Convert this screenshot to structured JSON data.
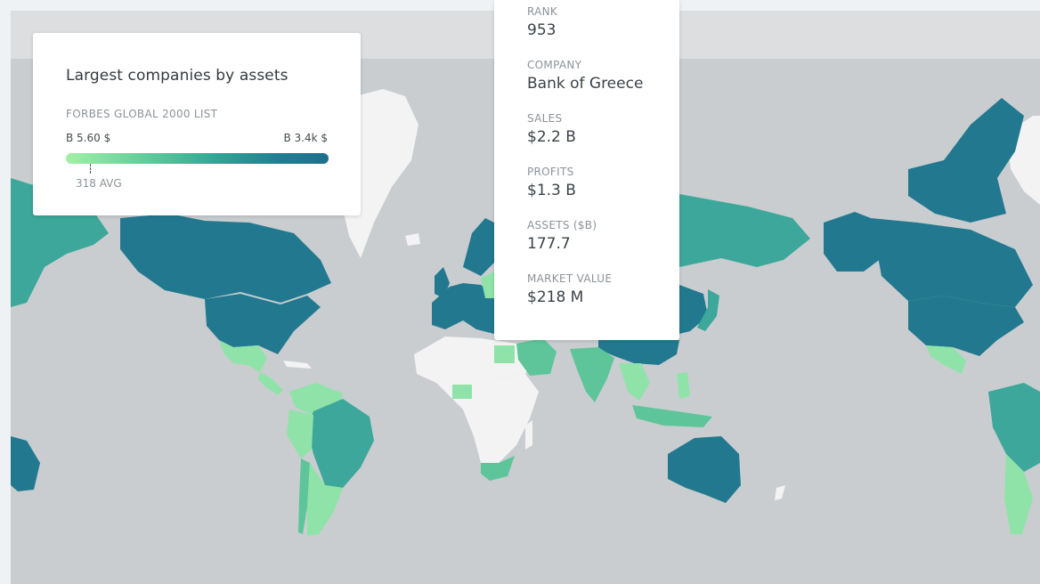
{
  "legend": {
    "title": "Largest companies by assets",
    "subtitle": "FORBES GLOBAL 2000 LIST",
    "min_label": "B 5.60 $",
    "max_label": "B 3.4k $",
    "avg_label": "318 AVG",
    "scale_colors": [
      "#a3f0a6",
      "#62cc9a",
      "#34a996",
      "#237f92",
      "#1f6f8b"
    ]
  },
  "tooltip": {
    "fields": [
      {
        "label": "RANK",
        "value": "953"
      },
      {
        "label": "COMPANY",
        "value": "Bank of Greece"
      },
      {
        "label": "SALES",
        "value": "$2.2 B"
      },
      {
        "label": "PROFITS",
        "value": "$1.3 B"
      },
      {
        "label": "ASSETS ($B)",
        "value": "177.7"
      },
      {
        "label": "MARKET VALUE",
        "value": "$218 M"
      }
    ]
  },
  "colors": {
    "ocean": "#c9cdd0",
    "no_data": "#f3f3f3",
    "light": "#8fe3a8",
    "mid_light": "#5ec59a",
    "mid": "#3ca79a",
    "dark": "#22798f"
  }
}
